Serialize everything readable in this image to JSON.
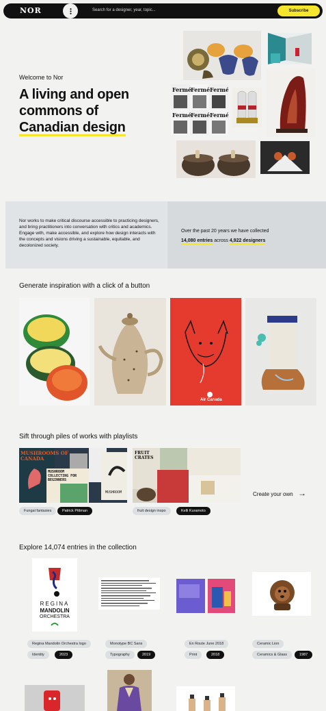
{
  "header": {
    "logo": "NOR",
    "menu_icon": "vertical-dots-icon",
    "search_placeholder": "Search for a designer, year, topic...",
    "subscribe_label": "Subscribe"
  },
  "hero": {
    "welcome": "Welcome to Nor",
    "title_lines": [
      "A living and open",
      "commons of",
      "Canadian design"
    ],
    "book_cover_text": "Fermé"
  },
  "about": {
    "mission": "Nor works to make critical discourse accessible to practicing designers, and bring practitioners into conversation with critics and academics. Engage with, make accessible, and explore how design interacts with the concepts and visions driving a sustainable, equitable, and decolonized society.",
    "stat_intro": "Over the past 20 years we have collected",
    "entries": "14,080 entries",
    "across": "across",
    "designers": "4,922 designers"
  },
  "inspiration": {
    "title": "Generate inspiration with a click of a button",
    "poster_brand": "Air Canada"
  },
  "playlists": {
    "title": "Sift through piles of works with  playlists",
    "items": [
      {
        "name": "Fungal fantasies",
        "curator": "Patrick Pittman",
        "cover_text": "MUSHROOM COLLECTING FOR BEGINNERS",
        "cover_text2": "MUSHROOM",
        "cover_text3": "MUSHROOMS OF CANADA"
      },
      {
        "name": "fruit design inspo",
        "curator": "Kelli Kuramoto",
        "cover_text": "FRUIT CRATES"
      }
    ],
    "create_label": "Create your own",
    "create_arrow": "→"
  },
  "collection": {
    "title": "Explore 14,074 entries in the collection",
    "entries": [
      {
        "name": "Regina Mandolin Orchestra logo",
        "category": "Identity",
        "year": "2023",
        "art_text": [
          "REGINA",
          "MANDOLIN",
          "ORCHESTRA"
        ]
      },
      {
        "name": "Monotype BC Sans",
        "category": "Typography",
        "year": "2019"
      },
      {
        "name": "En Route June 2018",
        "category": "Print",
        "year": "2018"
      },
      {
        "name": "Ceramic Lion",
        "category": "Ceramics & Glass",
        "year": "1987"
      }
    ]
  },
  "colors": {
    "accent_yellow": "#f5e52c",
    "background": "#f2f2f0",
    "band": "#e1e4e6",
    "dark": "#111111"
  }
}
